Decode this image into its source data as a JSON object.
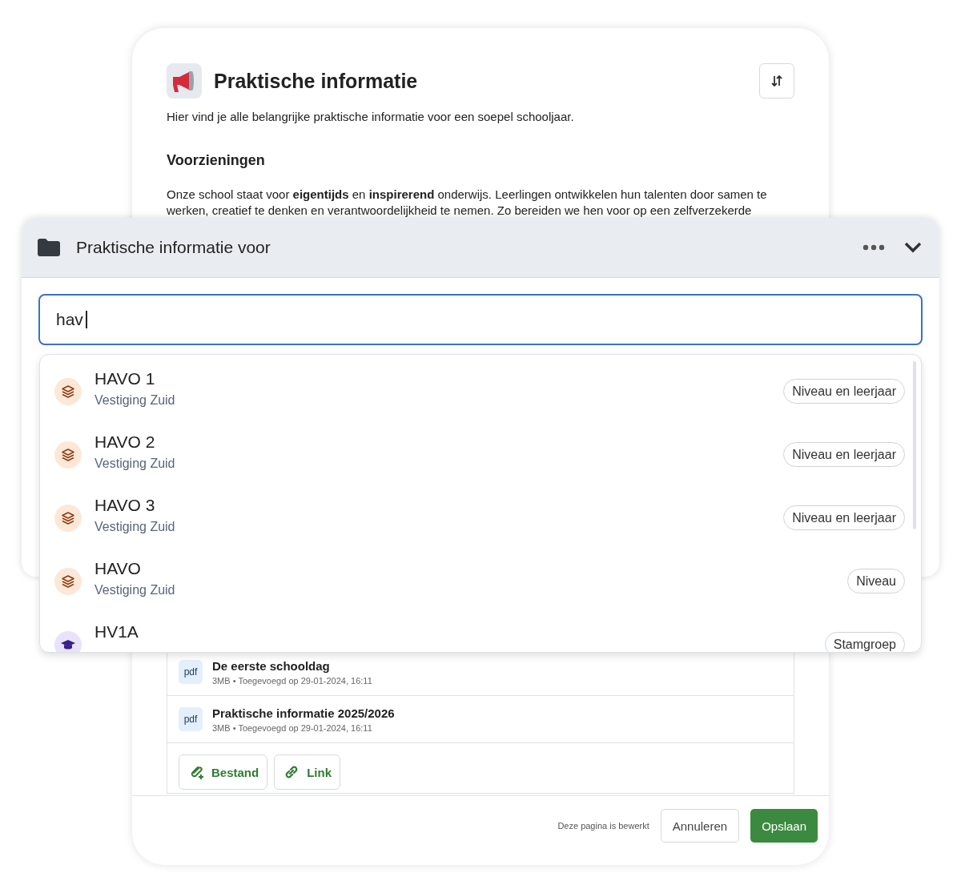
{
  "page": {
    "title": "Praktische informatie",
    "intro": "Hier vind je alle belangrijke praktische informatie voor een soepel schooljaar.",
    "section_heading": "Voorzieningen",
    "paragraph": "Onze school staat voor **eigentijds** en **inspirerend** onderwijs. Leerlingen ontwikkelen hun talenten door samen te werken, creatief te denken en verantwoordelijkheid te nemen. Zo bereiden we hen voor op een zelfverzekerde"
  },
  "files": [
    {
      "type": "pdf",
      "name": "De eerste schooldag",
      "meta": "3MB • Toegevoegd op 29-01-2024, 16:11"
    },
    {
      "type": "pdf",
      "name": "Praktische informatie 2025/2026",
      "meta": "3MB • Toegevoegd op 29-01-2024, 16:11"
    }
  ],
  "add_buttons": [
    {
      "kind": "file",
      "label": "Bestand"
    },
    {
      "kind": "link",
      "label": "Link"
    }
  ],
  "footer": {
    "status": "Deze pagina is bewerkt",
    "cancel": "Annuleren",
    "save": "Opslaan"
  },
  "panel": {
    "title": "Praktische informatie voor",
    "search": {
      "value": "hav"
    }
  },
  "results": [
    {
      "kind": "level",
      "title": "HAVO 1",
      "subtitle": "Vestiging Zuid",
      "tag": "Niveau en leerjaar"
    },
    {
      "kind": "level",
      "title": "HAVO 2",
      "subtitle": "Vestiging Zuid",
      "tag": "Niveau en leerjaar"
    },
    {
      "kind": "level",
      "title": "HAVO 3",
      "subtitle": "Vestiging Zuid",
      "tag": "Niveau en leerjaar"
    },
    {
      "kind": "level",
      "title": "HAVO",
      "subtitle": "Vestiging Zuid",
      "tag": "Niveau"
    },
    {
      "kind": "group",
      "title": "HV1A",
      "tag": "Stamgroep"
    }
  ]
}
